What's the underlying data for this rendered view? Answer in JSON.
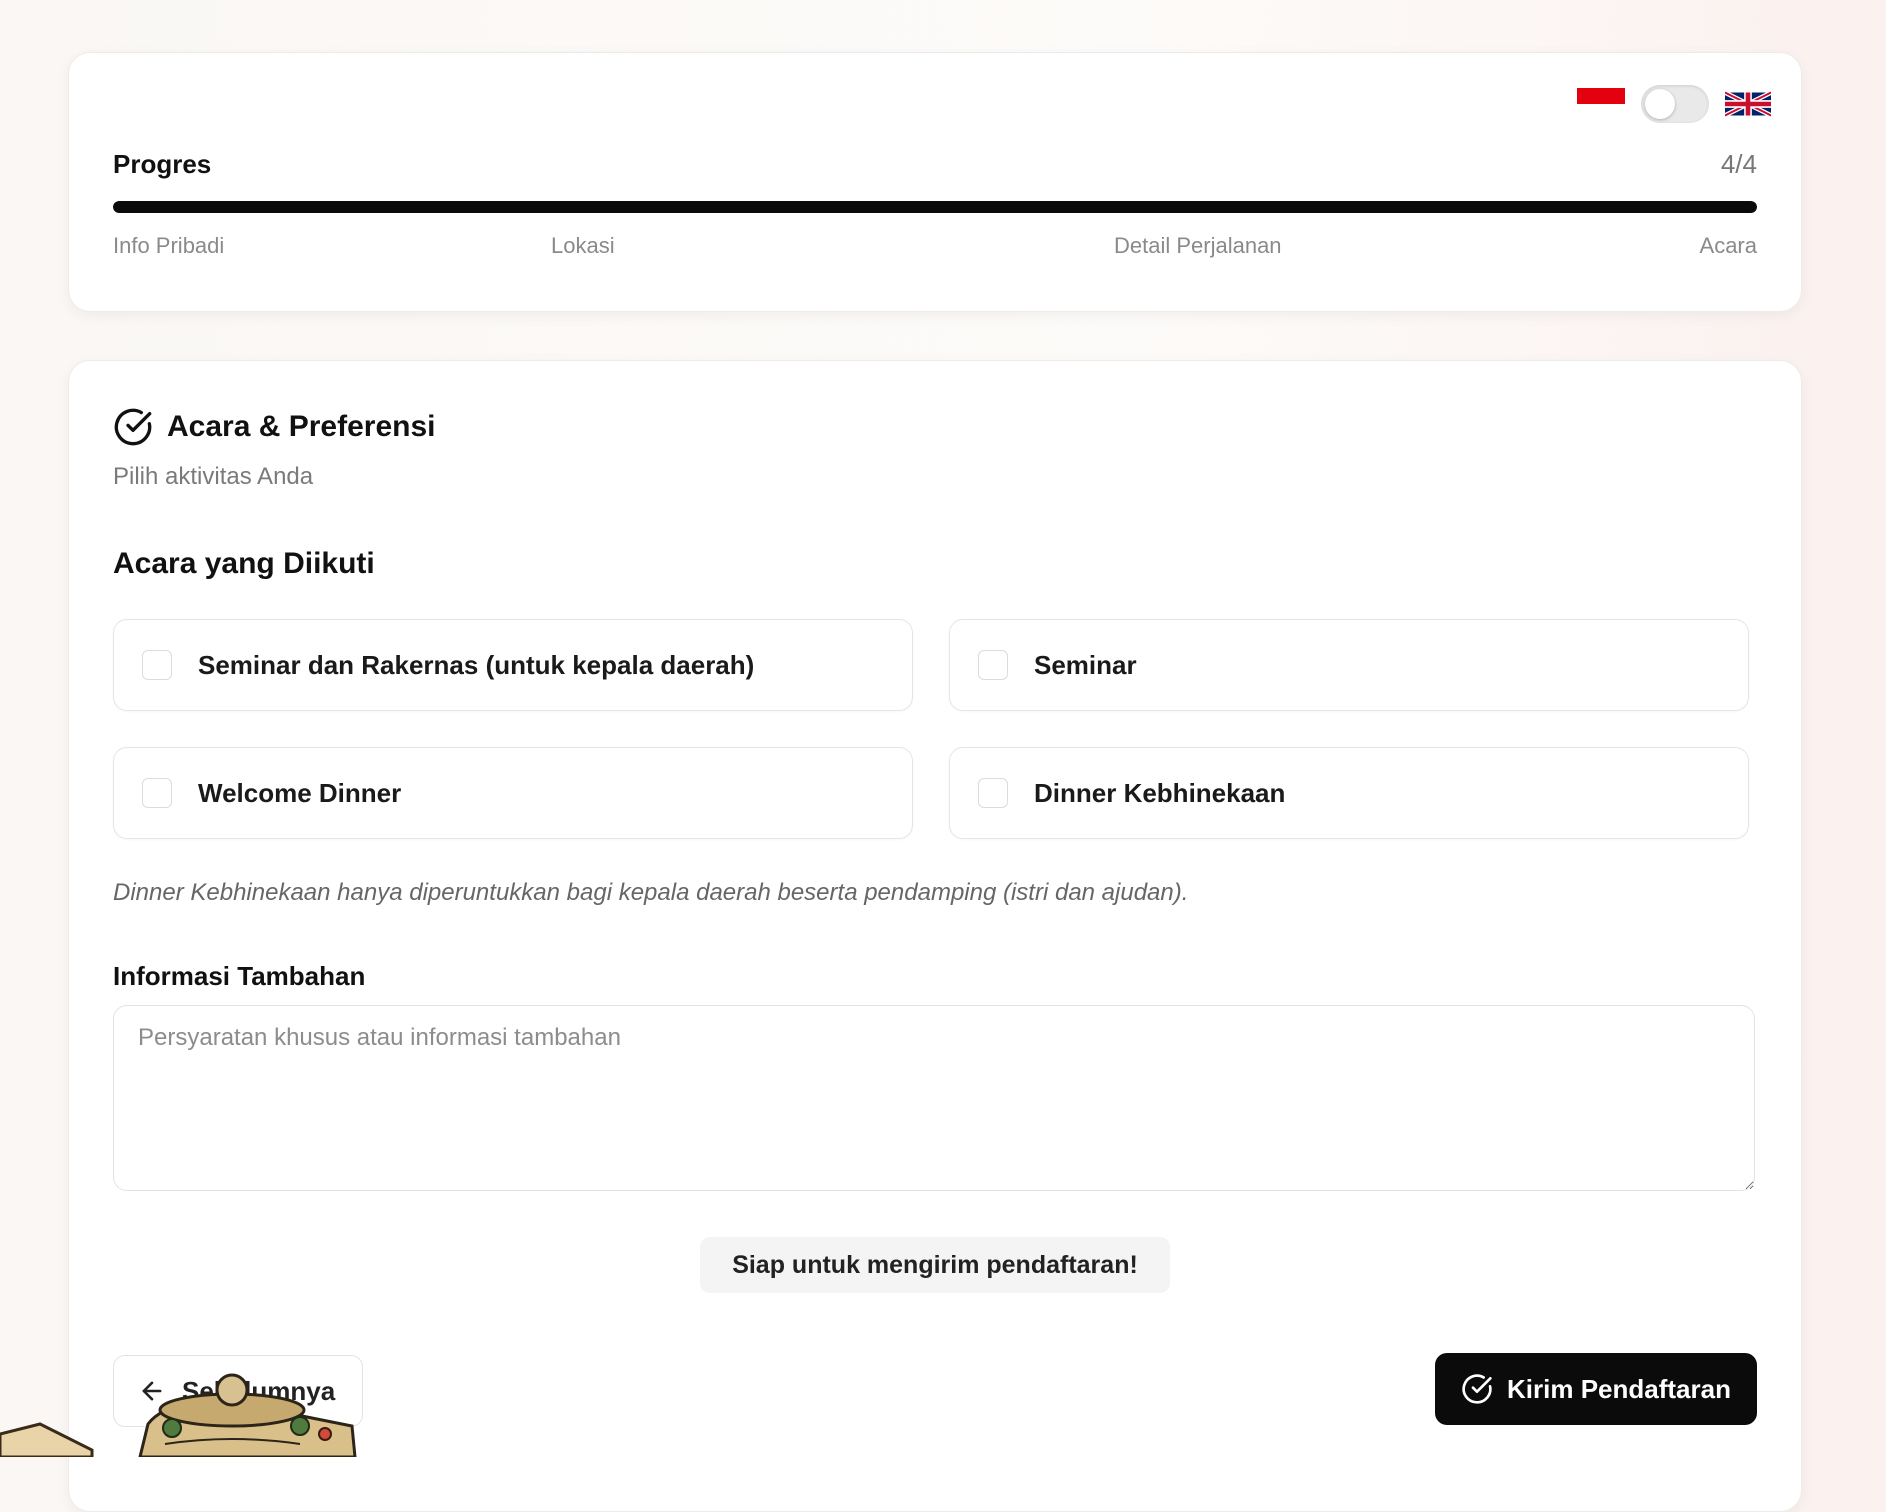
{
  "language": {
    "active": "id",
    "toggle_on": false
  },
  "progress": {
    "label": "Progres",
    "count": "4/4",
    "fraction": 1.0,
    "steps": [
      "Info Pribadi",
      "Lokasi",
      "Detail Perjalanan",
      "Acara"
    ]
  },
  "section": {
    "title": "Acara & Preferensi",
    "subtitle": "Pilih aktivitas Anda"
  },
  "events": {
    "title": "Acara yang Diikuti",
    "options": [
      {
        "label": "Seminar dan Rakernas (untuk kepala daerah)",
        "checked": false
      },
      {
        "label": "Seminar",
        "checked": false
      },
      {
        "label": "Welcome Dinner",
        "checked": false
      },
      {
        "label": "Dinner Kebhinekaan",
        "checked": false
      }
    ],
    "note": "Dinner Kebhinekaan hanya diperuntukkan bagi kepala daerah beserta pendamping (istri dan ajudan)."
  },
  "additional_info": {
    "label": "Informasi Tambahan",
    "value": "",
    "placeholder": "Persyaratan khusus atau informasi tambahan"
  },
  "status": {
    "ready_text": "Siap untuk mengirim pendaftaran!"
  },
  "buttons": {
    "prev_label": "Sebelumnya",
    "submit_label": "Kirim Pendaftaran"
  },
  "colors": {
    "accent": "#0b0b0b",
    "flag_red": "#e3000f",
    "muted_text": "#8a8a8a"
  },
  "icons": {
    "section": "circle-check-icon",
    "prev": "arrow-left-icon",
    "submit": "circle-check-icon"
  }
}
